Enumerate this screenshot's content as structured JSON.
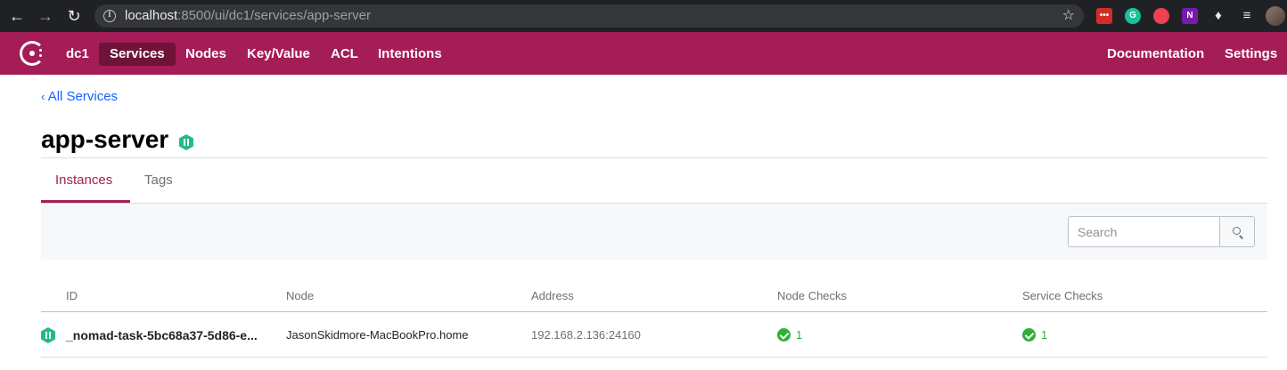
{
  "browser": {
    "url_host": "localhost",
    "url_path": ":8500/ui/dc1/services/app-server",
    "extensions": [
      {
        "name": "lastpass-icon",
        "label": "•••",
        "color": "#d32d27"
      },
      {
        "name": "grammarly-icon",
        "label": "G",
        "color": "#15c39a"
      },
      {
        "name": "pocket-icon",
        "label": "",
        "color": "#ef4056"
      },
      {
        "name": "onenote-icon",
        "label": "N",
        "color": "#7719aa"
      }
    ]
  },
  "appbar": {
    "datacenter": "dc1",
    "nav": [
      "Services",
      "Nodes",
      "Key/Value",
      "ACL",
      "Intentions"
    ],
    "active_nav": "Services",
    "right_nav": [
      "Documentation",
      "Settings"
    ],
    "brand_color": "#a51d56"
  },
  "page": {
    "back_link": "All Services",
    "title": "app-server",
    "tabs": [
      "Instances",
      "Tags"
    ],
    "active_tab": "Instances"
  },
  "search": {
    "placeholder": "Search"
  },
  "table": {
    "columns": [
      "ID",
      "Node",
      "Address",
      "Node Checks",
      "Service Checks"
    ],
    "rows": [
      {
        "id": "_nomad-task-5bc68a37-5d86-e...",
        "node": "JasonSkidmore-MacBookPro.home",
        "address": "192.168.2.136:24160",
        "node_checks": "1",
        "service_checks": "1"
      }
    ]
  }
}
